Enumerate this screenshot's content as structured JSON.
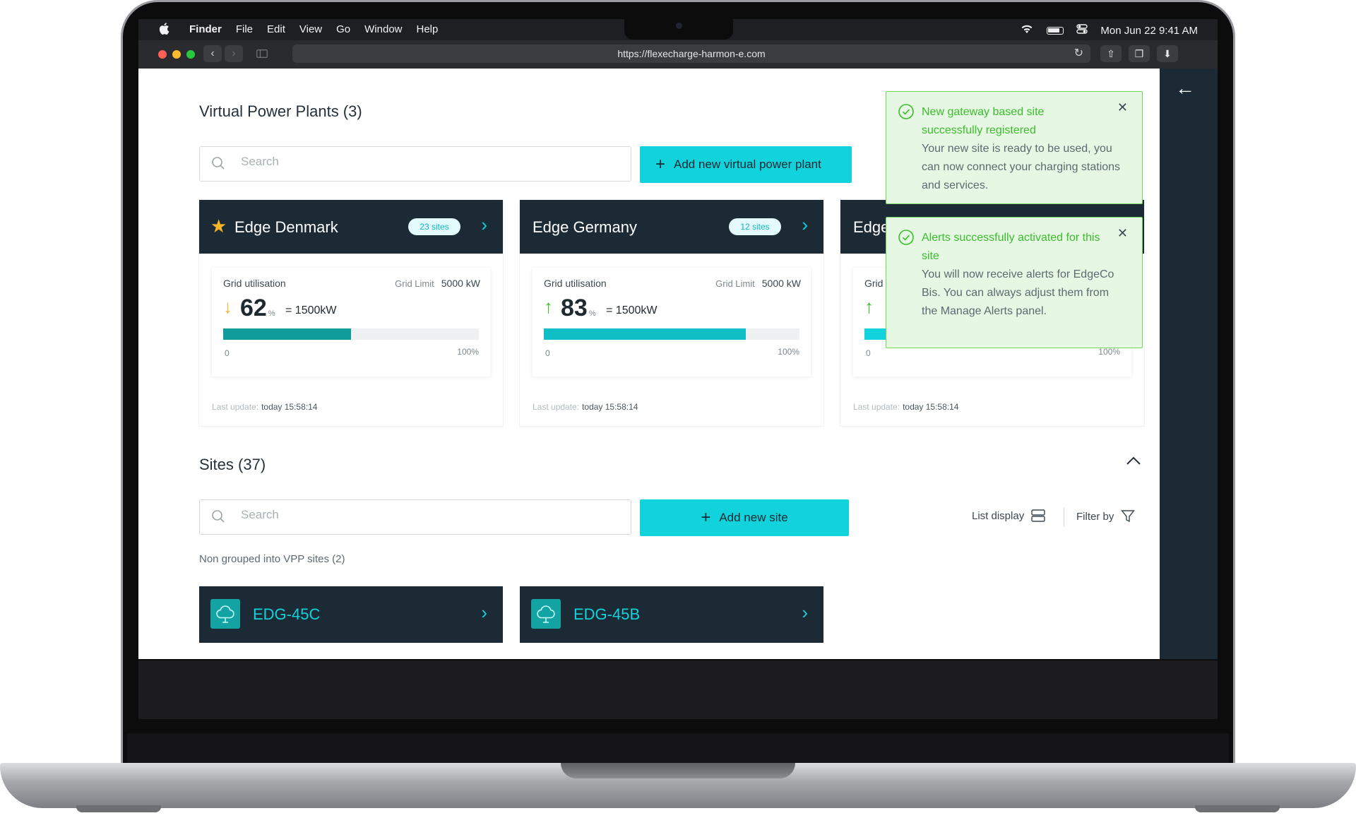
{
  "menubar": {
    "apple": "",
    "items": [
      "Finder",
      "File",
      "Edit",
      "View",
      "Go",
      "Window",
      "Help"
    ],
    "datetime": "Mon Jun 22  9:41 AM"
  },
  "browser": {
    "url": "https://flexecharge-harmon-e.com"
  },
  "vpp": {
    "title": "Virtual Power Plants (3)",
    "search_placeholder": "Search",
    "add_label": "Add new virtual power plant",
    "cards": [
      {
        "name": "Edge Denmark",
        "starred": true,
        "badge": "23 sites",
        "utilisation_label": "Grid utilisation",
        "limit_label": "Grid Limit",
        "limit_value": "5000 kW",
        "trend": "down",
        "percent": "62",
        "percent_unit": "%",
        "kw": "= 1500kW",
        "fill_fraction": 0.5,
        "fill_color": "#0f9c9b",
        "scale_min": "0",
        "scale_max": "100%",
        "last_update_label": "Last update:",
        "last_update_value": "today 15:58:14"
      },
      {
        "name": "Edge Germany",
        "starred": false,
        "badge": "12 sites",
        "utilisation_label": "Grid utilisation",
        "limit_label": "Grid Limit",
        "limit_value": "5000 kW",
        "trend": "up",
        "percent": "83",
        "percent_unit": "%",
        "kw": "= 1500kW",
        "fill_fraction": 0.79,
        "fill_color": "#10bfc6",
        "scale_min": "0",
        "scale_max": "100%",
        "last_update_label": "Last update:",
        "last_update_value": "today 15:58:14"
      },
      {
        "name": "Edge",
        "starred": false,
        "badge": "",
        "utilisation_label": "Grid",
        "limit_label": "",
        "limit_value": "",
        "trend": "up",
        "percent": "",
        "percent_unit": "",
        "kw": "",
        "fill_fraction": 0.1,
        "fill_color": "#12d3dc",
        "scale_min": "0",
        "scale_max": "100%",
        "last_update_label": "Last update:",
        "last_update_value": "today 15:58:14"
      }
    ]
  },
  "toasts": [
    {
      "title": "New gateway based site successfully registered",
      "message": "Your new site is ready to be used, you can now connect your charging stations and services."
    },
    {
      "title": "Alerts successfully activated for this site",
      "message": "You will now receive alerts for EdgeCo Bis. You can always adjust them from the Manage Alerts panel."
    }
  ],
  "sites": {
    "title": "Sites (37)",
    "search_placeholder": "Search",
    "add_label": "Add new site",
    "list_display": "List display",
    "filter_by": "Filter by",
    "non_grouped": "Non grouped into VPP sites (2)",
    "cards": [
      {
        "name": "EDG-45C"
      },
      {
        "name": "EDG-45B"
      }
    ]
  },
  "colors": {
    "accent": "#12d3dc",
    "dark": "#1b2a35",
    "success": "#3bbd2c",
    "star": "#f7b52a"
  }
}
